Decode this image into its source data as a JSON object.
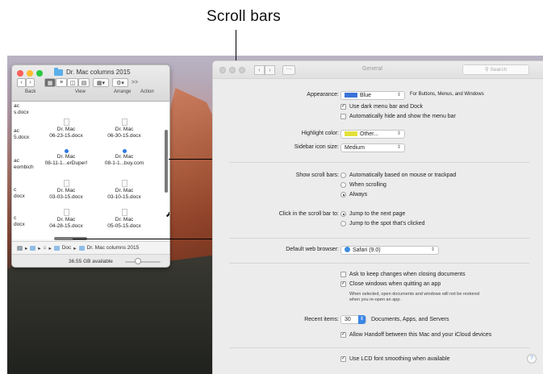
{
  "callout": {
    "label": "Scroll bars"
  },
  "finder": {
    "title": "Dr. Mac columns 2015",
    "toolbar_labels": {
      "back": "Back",
      "view": "View",
      "arrange": "Arrange",
      "action": "Action"
    },
    "more": ">>",
    "left_files": [
      {
        "line1": "ac",
        "line2": "s.docx"
      },
      {
        "line1": "ac",
        "line2": "5.docx"
      },
      {
        "line1": "ac",
        "line2": "eombich"
      },
      {
        "line1": "c",
        "line2": "docx"
      },
      {
        "line1": "c",
        "line2": "docx"
      }
    ],
    "files": [
      {
        "line1": "Dr. Mac",
        "line2": "06-23-15.docx",
        "marker": "doc"
      },
      {
        "line1": "Dr. Mac",
        "line2": "06-30-15.docx",
        "marker": "doc"
      },
      {
        "line1": "Dr. Mac",
        "line2": "08-11-1...erDuper!",
        "marker": "dot"
      },
      {
        "line1": "Dr. Mac",
        "line2": "08-1-1...buy.com",
        "marker": "dot"
      },
      {
        "line1": "Dr. Mac",
        "line2": "03-03-15.docx",
        "marker": "doc"
      },
      {
        "line1": "Dr. Mac",
        "line2": "03-10-15.docx",
        "marker": "doc"
      },
      {
        "line1": "Dr. Mac",
        "line2": "04-28-15.docx",
        "marker": "doc"
      },
      {
        "line1": "Dr. Mac",
        "line2": "05-05-15.docx",
        "marker": "doc"
      }
    ],
    "pathbar": {
      "doc": "Doc",
      "folder": "Dr. Mac columns 2015"
    },
    "available": "36.55 GB available"
  },
  "prefs": {
    "title": "General",
    "search_placeholder": "Search",
    "appearance": {
      "label": "Appearance:",
      "value": "Blue",
      "note": "For Buttons, Menus, and Windows",
      "swatch": "#3b72d9"
    },
    "dark_menu": "Use dark menu bar and Dock",
    "auto_hide": "Automatically hide and show the menu bar",
    "highlight": {
      "label": "Highlight color:",
      "value": "Other...",
      "swatch": "#e3e03a"
    },
    "sidebar_size": {
      "label": "Sidebar icon size:",
      "value": "Medium"
    },
    "show_scroll": {
      "label": "Show scroll bars:",
      "options": [
        "Automatically based on mouse or trackpad",
        "When scrolling",
        "Always"
      ],
      "selected": 2
    },
    "click_scroll": {
      "label": "Click in the scroll bar to:",
      "options": [
        "Jump to the next page",
        "Jump to the spot that's clicked"
      ],
      "selected": 0
    },
    "browser": {
      "label": "Default web browser:",
      "value": "Safari (9.0)"
    },
    "ask_keep": "Ask to keep changes when closing documents",
    "close_windows": "Close windows when quitting an app",
    "close_note": [
      "When selected, open documents and windows will not be restored",
      "when you re-open an app."
    ],
    "recent": {
      "label": "Recent items:",
      "value": "30",
      "text": "Documents, Apps, and Servers"
    },
    "handoff": "Allow Handoff between this Mac and your iCloud devices",
    "lcd": "Use LCD font smoothing when available",
    "help": "?"
  }
}
